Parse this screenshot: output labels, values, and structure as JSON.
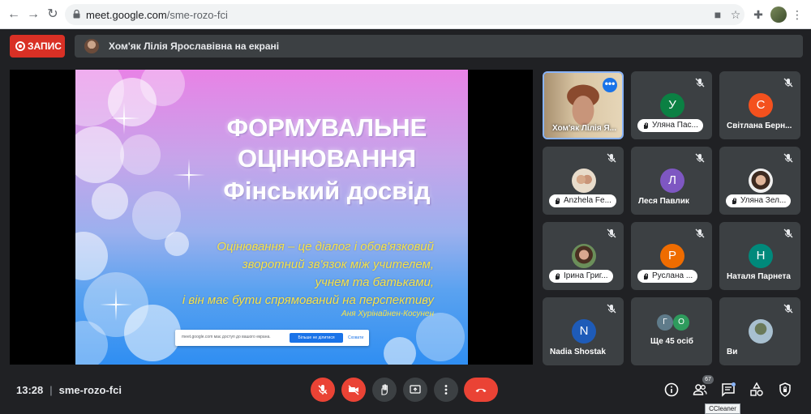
{
  "browser": {
    "url_host": "meet.google.com",
    "url_path": "/sme-rozo-fci"
  },
  "meet": {
    "record_label": "ЗАПИС",
    "presenting_text": "Хом'як Лілія Ярославівна на екрані",
    "meeting_time": "13:28",
    "meeting_code": "sme-rozo-fci",
    "participants_count": "67",
    "tooltip": "CCleaner"
  },
  "slide": {
    "title_line1": "ФОРМУВАЛЬНЕ",
    "title_line2": "ОЦІНЮВАННЯ",
    "title_line3": "Фінський досвід",
    "quote_line1": "Оцінювання – це діалог і обов'язковий",
    "quote_line2": "зворотний зв'язок між учителем,",
    "quote_line3": "учнем та батьками,",
    "quote_line4": "і він має бути спрямований на перспективу",
    "author": "Аня Хурінайнен-Косунен",
    "share_message": "meet.google.com має доступ до вашого екрана.",
    "share_stop": "Більше не ділитися",
    "share_hide": "Сховати"
  },
  "tiles": {
    "t1": {
      "name": "Хом'як Лілія Я..."
    },
    "t2": {
      "name": "Уляна Пас...",
      "letter": "У",
      "color": "#0b8043"
    },
    "t3": {
      "name": "Світлана Берн...",
      "letter": "С",
      "color": "#f4511e"
    },
    "t4": {
      "name": "Anzhela Fe..."
    },
    "t5": {
      "name": "Леся Павлик",
      "letter": "Л",
      "color": "#7e57c2"
    },
    "t6": {
      "name": "Уляна Зел..."
    },
    "t7": {
      "name": "Ірина Григ..."
    },
    "t8": {
      "name": "Руслана ...",
      "letter": "Р",
      "color": "#ef6c00"
    },
    "t9": {
      "name": "Наталя Парнета",
      "letter": "Н",
      "color": "#00897b"
    },
    "t10": {
      "name": "Nadia Shostak",
      "letter": "N",
      "color": "#1e5bb8"
    },
    "t11": {
      "name": "Ще 45 осіб",
      "letter_a": "Г",
      "letter_b": "О",
      "color_a": "#5f7b8a",
      "color_b": "#2e9b5d"
    },
    "t12": {
      "name": "Ви"
    }
  }
}
